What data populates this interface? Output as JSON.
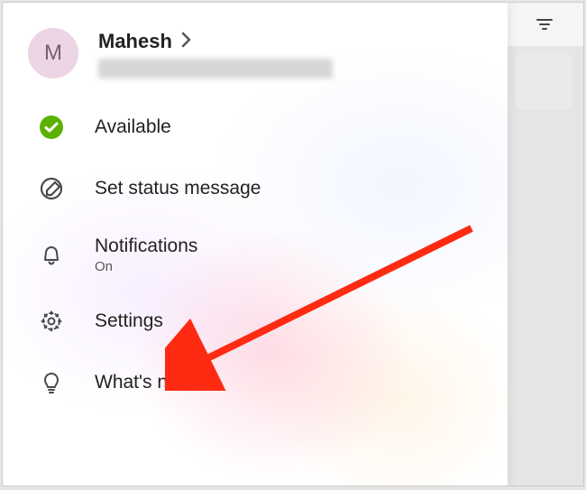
{
  "profile": {
    "avatar_initial": "M",
    "name": "Mahesh",
    "avatar_bg": "#ecd5e5",
    "avatar_fg": "#7b5c74"
  },
  "status": {
    "presence": "Available",
    "presence_color": "#5cb100"
  },
  "menu": {
    "set_status": "Set status message",
    "notifications_label": "Notifications",
    "notifications_value": "On",
    "settings": "Settings",
    "whats_new": "What's new"
  }
}
